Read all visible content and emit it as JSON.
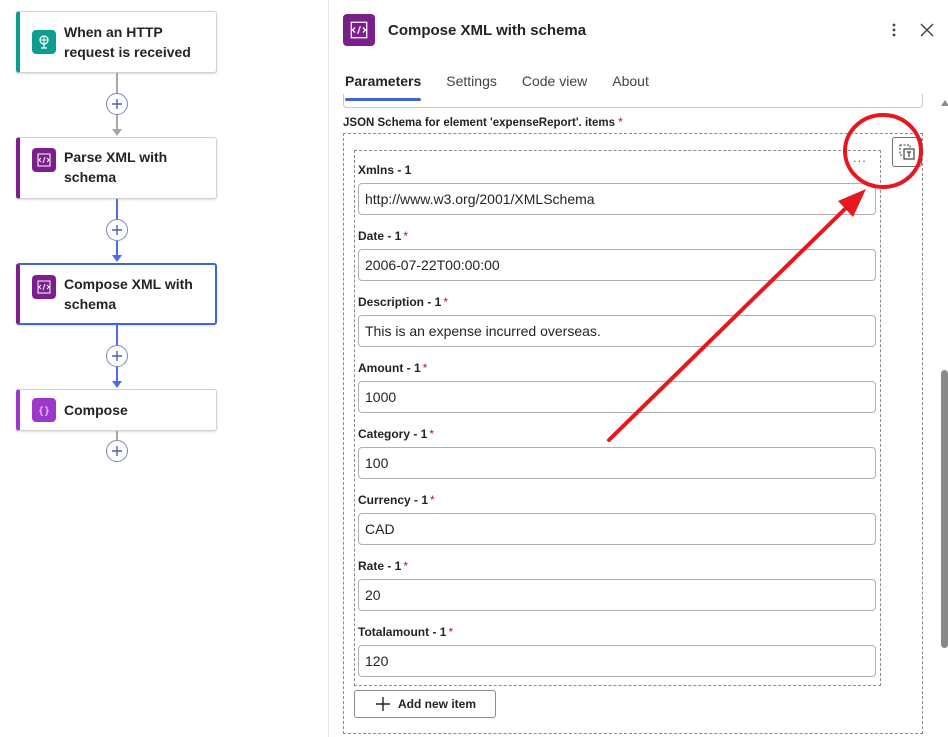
{
  "flow": {
    "steps": [
      {
        "label": "When an HTTP request is received",
        "icon": "http-request-icon",
        "color": "#0f9d8f"
      },
      {
        "label": "Parse XML with schema",
        "icon": "xml-icon",
        "color": "#7a1f8c"
      },
      {
        "label": "Compose XML with schema",
        "icon": "xml-icon",
        "color": "#7a1f8c",
        "selected": true
      },
      {
        "label": "Compose",
        "icon": "compose-icon",
        "color": "#9b38c9"
      }
    ]
  },
  "panel": {
    "title": "Compose XML with schema",
    "tabs": [
      "Parameters",
      "Settings",
      "Code view",
      "About"
    ],
    "active_tab": "Parameters",
    "schema_label": "JSON Schema for element 'expenseReport'. items",
    "required_marker": "*",
    "fields": [
      {
        "label": "Xmlns - 1",
        "required": false,
        "value": "http://www.w3.org/2001/XMLSchema"
      },
      {
        "label": "Date - 1",
        "required": true,
        "value": "2006-07-22T00:00:00"
      },
      {
        "label": "Description - 1",
        "required": true,
        "value": "This is an expense incurred overseas."
      },
      {
        "label": "Amount - 1",
        "required": true,
        "value": "1000"
      },
      {
        "label": "Category - 1",
        "required": true,
        "value": "100"
      },
      {
        "label": "Currency - 1",
        "required": true,
        "value": "CAD"
      },
      {
        "label": "Rate - 1",
        "required": true,
        "value": "20"
      },
      {
        "label": "Totalamount - 1",
        "required": true,
        "value": "120"
      }
    ],
    "ellipsis": "...",
    "add_button_label": "Add new item"
  },
  "annotation": {
    "color": "#e8161d"
  }
}
